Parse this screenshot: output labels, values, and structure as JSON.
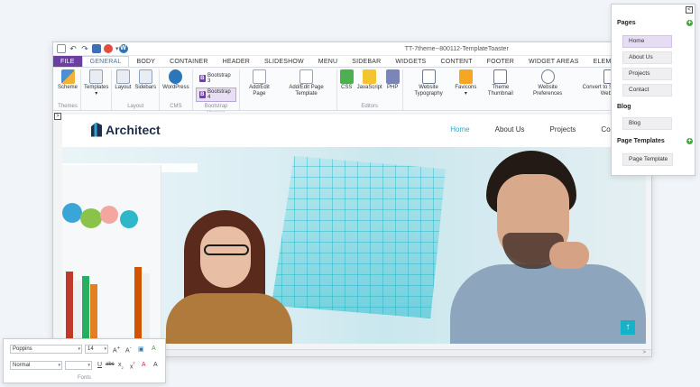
{
  "window": {
    "title": "TT-7theme--800112-TemplateToaster"
  },
  "menu": {
    "tabs": [
      "FILE",
      "GENERAL",
      "BODY",
      "CONTAINER",
      "HEADER",
      "SLIDESHOW",
      "MENU",
      "SIDEBAR",
      "WIDGETS",
      "CONTENT",
      "FOOTER",
      "WIDGET AREAS",
      "ELEMENTS"
    ],
    "active": "GENERAL"
  },
  "ribbon": {
    "themes": {
      "scheme": "Scheme",
      "label": "Themes"
    },
    "templates": "Templates",
    "layout": {
      "layout": "Layout",
      "sidebars": "Sidebars",
      "label": "Layout"
    },
    "cms": {
      "wordpress": "WordPress",
      "label": "CMS"
    },
    "bootstrap": {
      "b3": "Bootstrap 3",
      "b4": "Bootstrap 4",
      "label": "Bootstrap Version",
      "b_icon": "B"
    },
    "pages": {
      "add_edit": "Add/Edit Page",
      "add_edit_template": "Add/Edit Page Template"
    },
    "editors": {
      "css": "CSS",
      "js": "JavaScript",
      "php": "PHP",
      "label": "Editors"
    },
    "typography": "Website Typography",
    "favicons": "Favicons",
    "thumbnail": "Theme Thumbnail",
    "prefs": "Website Preferences",
    "convert": "Convert to Single Page Website"
  },
  "site": {
    "logo": "Architect",
    "nav": [
      "Home",
      "About Us",
      "Projects",
      "Contact"
    ],
    "active_nav": "Home"
  },
  "pages_panel": {
    "pages_title": "Pages",
    "pages": [
      "Home",
      "About Us",
      "Projects",
      "Contact"
    ],
    "selected": "Home",
    "blog_title": "Blog",
    "blog_items": [
      "Blog"
    ],
    "templates_title": "Page Templates",
    "template_items": [
      "Page Template"
    ]
  },
  "fonts_panel": {
    "font_family": "Poppins",
    "font_size": "14",
    "style": "Normal",
    "label": "Fonts"
  },
  "colors": {
    "accent": "#6b3fa0",
    "nav_active": "#2fa6c9",
    "scroll_btn": "#15b3c8",
    "add_green": "#3faa3c"
  }
}
